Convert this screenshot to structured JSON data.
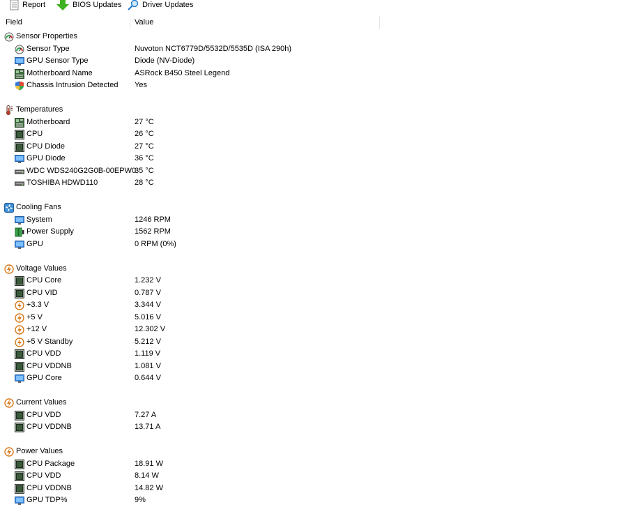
{
  "toolbar": {
    "report_label": "Report",
    "bios_label": "BIOS Updates",
    "driver_label": "Driver Updates"
  },
  "columns": {
    "field": "Field",
    "value": "Value"
  },
  "rows": [
    {
      "kind": "cat",
      "icon": "gauge-icon",
      "field": "Sensor Properties",
      "value": ""
    },
    {
      "kind": "item",
      "icon": "gauge-icon",
      "field": "Sensor Type",
      "value": "Nuvoton NCT6779D/5532D/5535D  (ISA 290h)"
    },
    {
      "kind": "item",
      "icon": "monitor-icon",
      "field": "GPU Sensor Type",
      "value": "Diode  (NV-Diode)"
    },
    {
      "kind": "item",
      "icon": "motherboard-icon",
      "field": "Motherboard Name",
      "value": "ASRock B450 Steel Legend"
    },
    {
      "kind": "item",
      "icon": "shield-icon",
      "field": "Chassis Intrusion Detected",
      "value": "Yes"
    },
    {
      "kind": "blank"
    },
    {
      "kind": "cat",
      "icon": "thermometer-icon",
      "field": "Temperatures",
      "value": ""
    },
    {
      "kind": "item",
      "icon": "motherboard-icon",
      "field": "Motherboard",
      "value": "27 °C"
    },
    {
      "kind": "item",
      "icon": "chip-icon",
      "field": "CPU",
      "value": "26 °C"
    },
    {
      "kind": "item",
      "icon": "chip-icon",
      "field": "CPU Diode",
      "value": "27 °C"
    },
    {
      "kind": "item",
      "icon": "monitor-icon",
      "field": "GPU Diode",
      "value": "36 °C"
    },
    {
      "kind": "item",
      "icon": "drive-icon",
      "field": "WDC WDS240G2G0B-00EPW0",
      "value": "35 °C"
    },
    {
      "kind": "item",
      "icon": "drive-icon",
      "field": "TOSHIBA HDWD110",
      "value": "28 °C"
    },
    {
      "kind": "blank"
    },
    {
      "kind": "cat",
      "icon": "fan-icon",
      "field": "Cooling Fans",
      "value": ""
    },
    {
      "kind": "item",
      "icon": "monitor-icon",
      "field": "System",
      "value": "1246 RPM"
    },
    {
      "kind": "item",
      "icon": "battery-icon",
      "field": "Power Supply",
      "value": "1562 RPM"
    },
    {
      "kind": "item",
      "icon": "monitor-icon",
      "field": "GPU",
      "value": "0 RPM  (0%)"
    },
    {
      "kind": "blank"
    },
    {
      "kind": "cat",
      "icon": "bolt-icon",
      "field": "Voltage Values",
      "value": ""
    },
    {
      "kind": "item",
      "icon": "chip-icon",
      "field": "CPU Core",
      "value": "1.232 V"
    },
    {
      "kind": "item",
      "icon": "chip-icon",
      "field": "CPU VID",
      "value": "0.787 V"
    },
    {
      "kind": "item",
      "icon": "bolt-icon",
      "field": "+3.3 V",
      "value": "3.344 V"
    },
    {
      "kind": "item",
      "icon": "bolt-icon",
      "field": "+5 V",
      "value": "5.016 V"
    },
    {
      "kind": "item",
      "icon": "bolt-icon",
      "field": "+12 V",
      "value": "12.302 V"
    },
    {
      "kind": "item",
      "icon": "bolt-icon",
      "field": "+5 V Standby",
      "value": "5.212 V"
    },
    {
      "kind": "item",
      "icon": "chip-icon",
      "field": "CPU VDD",
      "value": "1.119 V"
    },
    {
      "kind": "item",
      "icon": "chip-icon",
      "field": "CPU VDDNB",
      "value": "1.081 V"
    },
    {
      "kind": "item",
      "icon": "monitor-icon",
      "field": "GPU Core",
      "value": "0.644 V"
    },
    {
      "kind": "blank"
    },
    {
      "kind": "cat",
      "icon": "bolt-icon",
      "field": "Current Values",
      "value": ""
    },
    {
      "kind": "item",
      "icon": "chip-icon",
      "field": "CPU VDD",
      "value": "7.27 A"
    },
    {
      "kind": "item",
      "icon": "chip-icon",
      "field": "CPU VDDNB",
      "value": "13.71 A"
    },
    {
      "kind": "blank"
    },
    {
      "kind": "cat",
      "icon": "bolt-icon",
      "field": "Power Values",
      "value": ""
    },
    {
      "kind": "item",
      "icon": "chip-icon",
      "field": "CPU Package",
      "value": "18.91 W"
    },
    {
      "kind": "item",
      "icon": "chip-icon",
      "field": "CPU VDD",
      "value": "8.14 W"
    },
    {
      "kind": "item",
      "icon": "chip-icon",
      "field": "CPU VDDNB",
      "value": "14.82 W"
    },
    {
      "kind": "item",
      "icon": "monitor-icon",
      "field": "GPU TDP%",
      "value": "9%"
    }
  ]
}
